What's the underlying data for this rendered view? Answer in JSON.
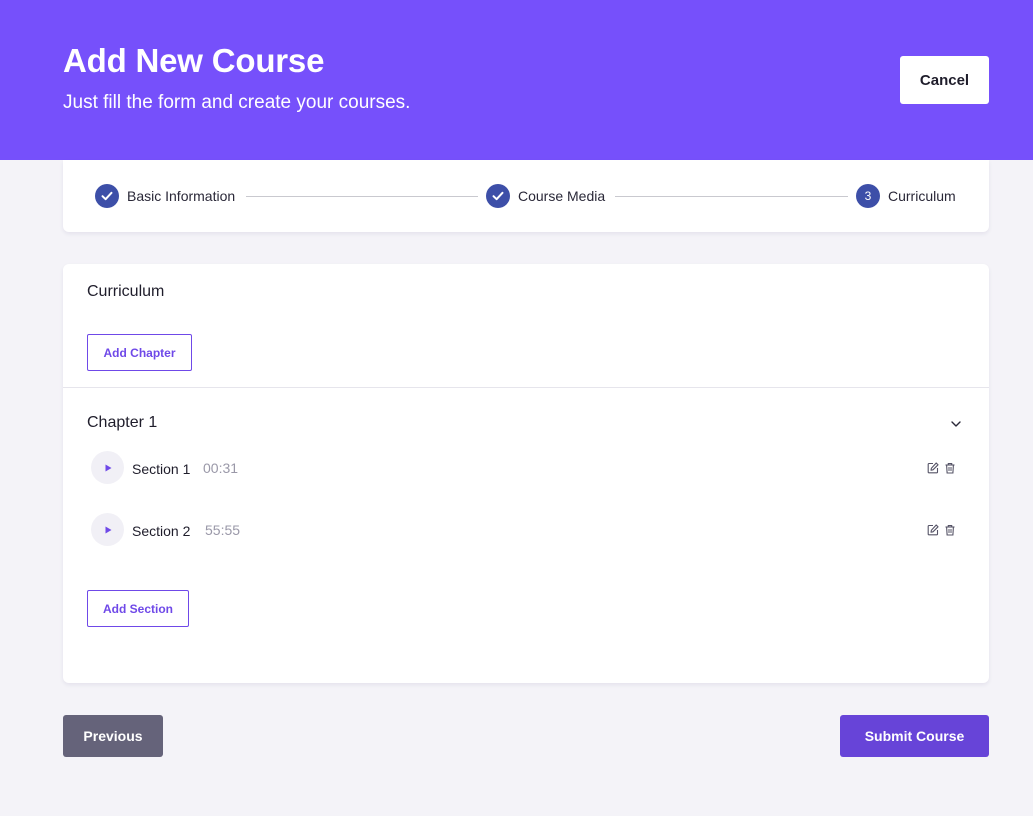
{
  "header": {
    "title": "Add New Course",
    "subtitle": "Just fill the form and create your courses.",
    "cancel_label": "Cancel",
    "background_color": "#7650fb"
  },
  "stepper": {
    "steps": [
      {
        "label": "Basic Information",
        "status": "completed",
        "icon": "check-icon"
      },
      {
        "label": "Course Media",
        "status": "completed",
        "icon": "check-icon"
      },
      {
        "label": "Curriculum",
        "status": "current",
        "number": "3"
      }
    ],
    "step_color": "#3d4fa8"
  },
  "curriculum": {
    "title": "Curriculum",
    "add_chapter_label": "Add Chapter",
    "chapters": [
      {
        "title": "Chapter 1",
        "expanded": true,
        "sections": [
          {
            "name": "Section 1",
            "duration": "00:31"
          },
          {
            "name": "Section 2",
            "duration": "55:55"
          }
        ],
        "add_section_label": "Add Section"
      }
    ]
  },
  "footer": {
    "previous_label": "Previous",
    "submit_label": "Submit Course",
    "accent_color": "#6744d8"
  }
}
